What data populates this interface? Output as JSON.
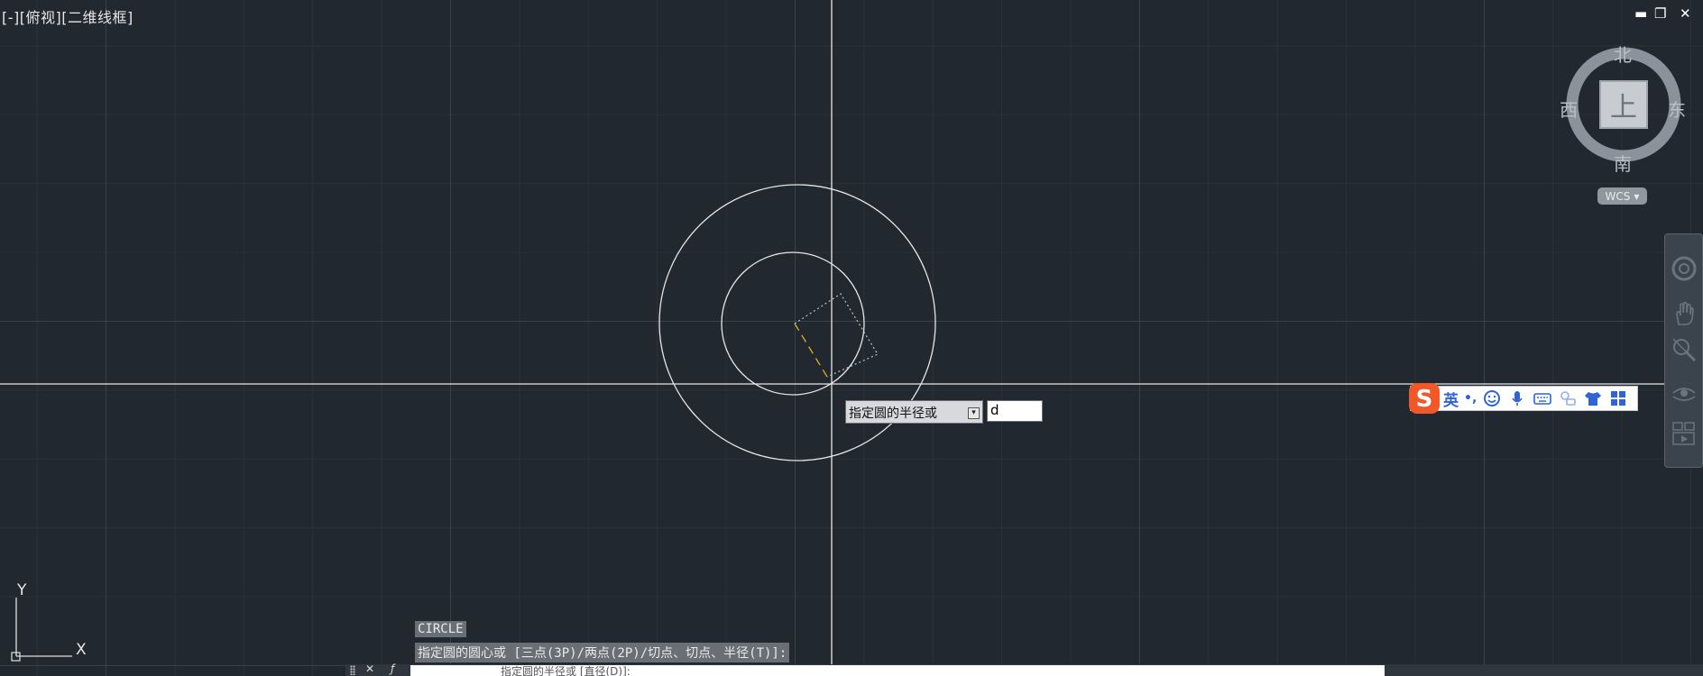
{
  "viewport": {
    "label": "[-][俯视][二维线框]"
  },
  "window_controls": {
    "minimize": "▬",
    "restore": "❐",
    "close": "✕"
  },
  "viewcube": {
    "north": "北",
    "south": "南",
    "east": "东",
    "west": "西",
    "face": "上",
    "wcs_label": "WCS",
    "wcs_arrow": "▾"
  },
  "ucs": {
    "x_label": "X",
    "y_label": "Y"
  },
  "dynamic_input": {
    "prompt": "指定圆的半径或",
    "option_icon": "▾",
    "value": "d"
  },
  "ime_toolbar": {
    "language": "英",
    "punctuation": "•,",
    "icons": [
      "smiley-icon",
      "microphone-icon",
      "keyboard-icon",
      "tools-icon",
      "tshirt-icon",
      "grid-icon"
    ]
  },
  "command_history": {
    "line1": "CIRCLE",
    "line2": "指定圆的圆心或 [三点(3P)/两点(2P)/切点、切点、半径(T)]:",
    "current_partial": "指定圆的半径或 [直径(D)]:"
  },
  "colors": {
    "background": "#212830",
    "geometry": "#e6e6e6",
    "radius_guide": "#e0b020",
    "ime_accent": "#2f63d6",
    "ime_logo": "#f0582a"
  }
}
